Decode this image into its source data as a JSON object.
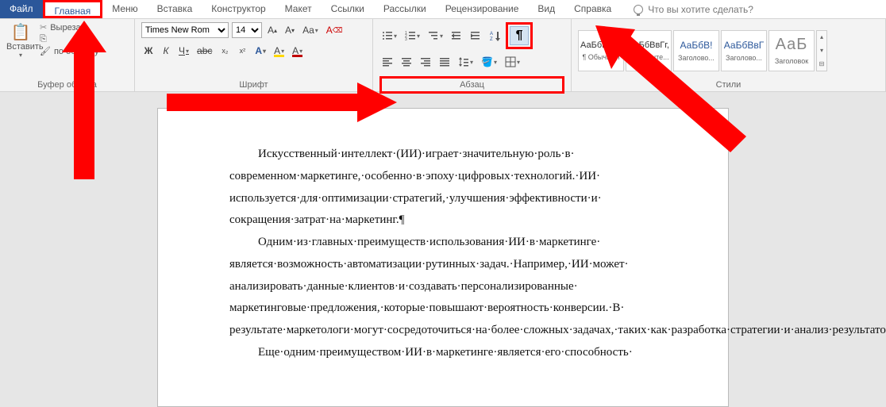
{
  "tabs": {
    "file": "Файл",
    "home": "Главная",
    "menu": "Меню",
    "insert": "Вставка",
    "design": "Конструктор",
    "layout": "Макет",
    "references": "Ссылки",
    "mailings": "Рассылки",
    "review": "Рецензирование",
    "view": "Вид",
    "help": "Справка",
    "tell_me": "Что вы хотите сделать?"
  },
  "clipboard": {
    "paste": "Вставить",
    "cut": "Вырезать",
    "copy_format": "по образцу",
    "group_label": "Буфер обмена"
  },
  "font": {
    "name": "Times New Rom",
    "size": "14",
    "group_label": "Шрифт",
    "bold": "Ж",
    "italic": "К",
    "underline": "Ч",
    "strike": "abc",
    "sub": "x₂",
    "sup": "x²",
    "text_effects": "A",
    "highlight": "A",
    "font_color": "A",
    "grow": "A",
    "grow2": "A",
    "case": "Aa",
    "clear": "A"
  },
  "paragraph": {
    "group_label": "Абзац",
    "pilcrow": "¶"
  },
  "styles": {
    "group_label": "Стили",
    "items": [
      {
        "sample": "АаБбВвГг,",
        "name": "¶ Обычный"
      },
      {
        "sample": "АаБбВвГг,",
        "name": "¶ Без инте..."
      },
      {
        "sample": "АаБбВ!",
        "name": "Заголово..."
      },
      {
        "sample": "АаБбВвГ",
        "name": "Заголово..."
      },
      {
        "sample": "АаБ",
        "name": "Заголовок"
      }
    ]
  },
  "document": {
    "p1": "Искусственный·интеллект·(ИИ)·играет·значительную·роль·в· современном·маркетинге,·особенно·в·эпоху·цифровых·технологий.·ИИ· используется·для·оптимизации·стратегий,·улучшения·эффективности·и· сокращения·затрат·на·маркетинг.¶",
    "p2": "Одним·из·главных·преимуществ·использования·ИИ·в·маркетинге· является·возможность·автоматизации·рутинных·задач.·Например,·ИИ·может· анализировать·данные·клиентов·и·создавать·персонализированные· маркетинговые·предложения,·которые·повышают·вероятность·конверсии.·В· результате·маркетологи·могут·сосредоточиться·на·более·сложных·задачах,·таких·как·разработка·стратегии·и·анализ·результатов.¶",
    "p3": "Еще·одним·преимуществом·ИИ·в·маркетинге·является·его·способность·"
  },
  "annotations": {
    "highlight_tab": "Главная",
    "highlight_group": "Абзац",
    "highlight_button": "show-hide-pilcrow"
  }
}
